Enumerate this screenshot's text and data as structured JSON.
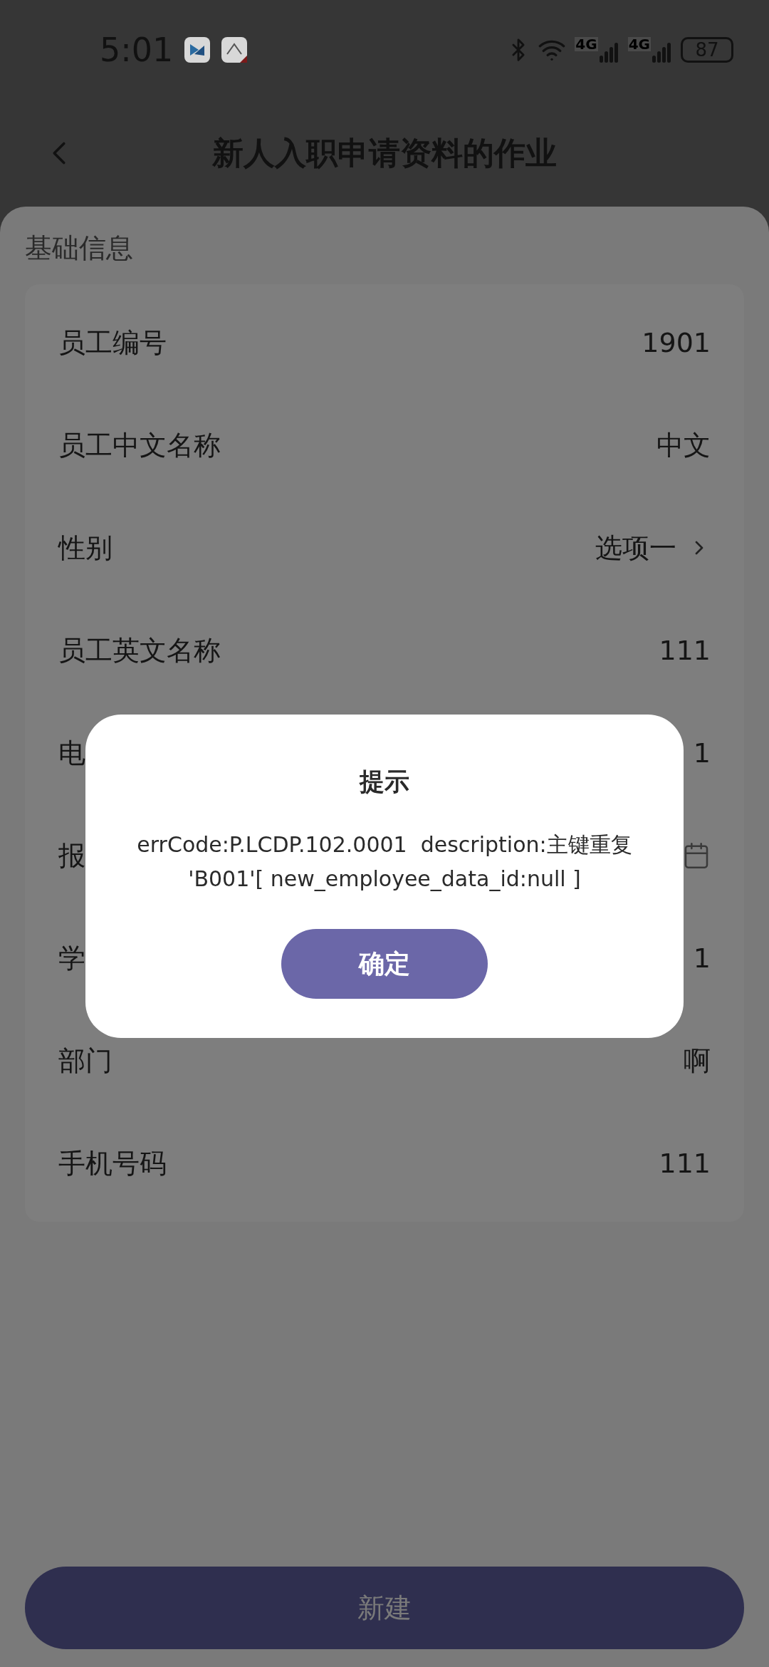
{
  "status_bar": {
    "time": "5:01",
    "network_1": "4G",
    "network_2": "4G",
    "battery": "87"
  },
  "header": {
    "title": "新人入职申请资料的作业"
  },
  "section": {
    "title": "基础信息"
  },
  "rows": [
    {
      "kind": "text",
      "label": "员工编号",
      "value": "1901"
    },
    {
      "kind": "text",
      "label": "员工中文名称",
      "value": "中文"
    },
    {
      "kind": "select",
      "label": "性别",
      "value": "选项一"
    },
    {
      "kind": "text",
      "label": "员工英文名称",
      "value": "111"
    },
    {
      "kind": "text",
      "label": "电",
      "value": "1"
    },
    {
      "kind": "date",
      "label": "报"
    },
    {
      "kind": "text",
      "label": "学",
      "value": "1"
    },
    {
      "kind": "text",
      "label": "部门",
      "value": "啊"
    },
    {
      "kind": "text",
      "label": "手机号码",
      "value": "111"
    }
  ],
  "submit_button": {
    "label": "新建"
  },
  "dialog": {
    "title": "提示",
    "message": "errCode:P.LCDP.102.0001  description:主键重复 'B001'[ new_employee_data_id:null ]",
    "confirm": "确定"
  }
}
